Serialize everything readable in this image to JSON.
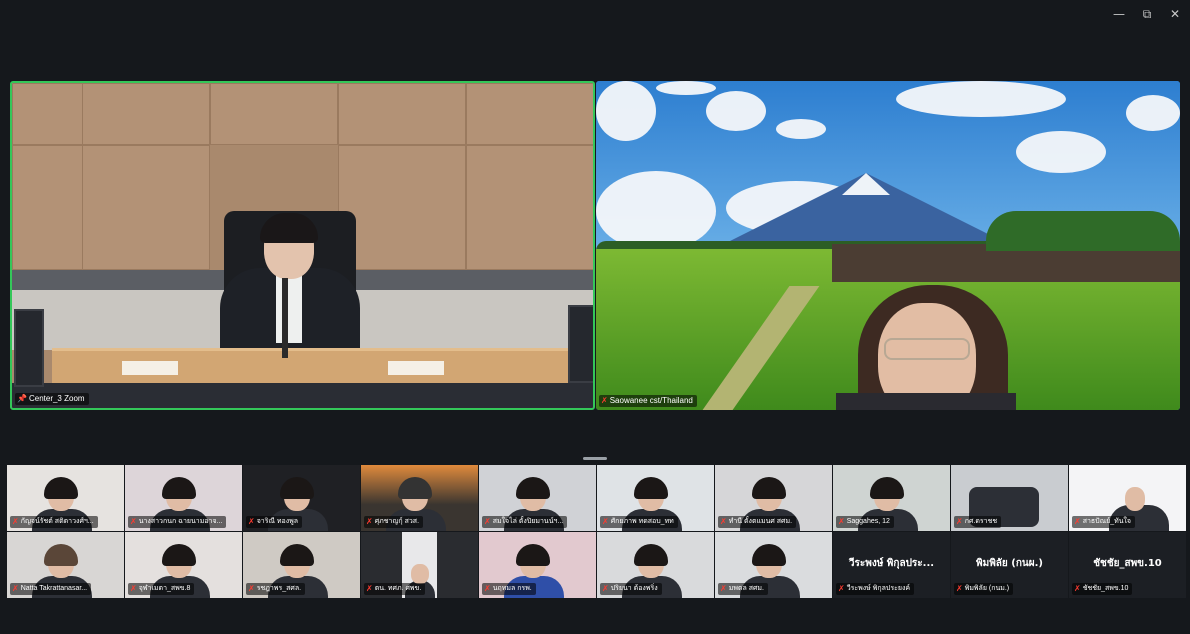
{
  "window": {
    "minimize_icon": "minimize-icon",
    "restore_icon": "restore-icon",
    "close_icon": "close-icon"
  },
  "main_speakers": [
    {
      "name": "Center_3 Zoom",
      "pinned": true,
      "muted": false,
      "active": true,
      "scene": "conference room"
    },
    {
      "name": "Saowanee cst/Thailand",
      "pinned": false,
      "muted": true,
      "active": false,
      "scene": "Mount Fuji tea field virtual background"
    }
  ],
  "participants": [
    {
      "name": "กัญจน์รัชต์ สติตาวงศ์ฯ...",
      "muted": true,
      "bg": "#e6e3e0"
    },
    {
      "name": "นางสาวกนก ฉายนามอาจ...",
      "muted": true,
      "bg": "#ddd5d9"
    },
    {
      "name": "จาริณี ทองพูล",
      "muted": true,
      "bg": "#1f2024"
    },
    {
      "name": "ศุภชาญกุ์ สวส.",
      "muted": true,
      "bg": "#3a3530"
    },
    {
      "name": "สมใจไล่ ตั้งปิยมานน์ฯ...",
      "muted": true,
      "bg": "#d0d2d6"
    },
    {
      "name": "ศักยภาพ ทดสอบ_ทท",
      "muted": true,
      "bg": "#dfe3e6"
    },
    {
      "name": "ทำนี ตั้งตแมนศ สศม.",
      "muted": true,
      "bg": "#d6d6d8"
    },
    {
      "name": "Saggahes, 12",
      "muted": true,
      "bg": "#cfd4d2"
    },
    {
      "name": "กศ.ดราชช",
      "muted": true,
      "bg": "#c9ccd0"
    },
    {
      "name": "สาธปัณย์_ทันใจ",
      "muted": true,
      "bg": "#f4f4f6"
    },
    {
      "name": "Natta Takrattanasar...",
      "muted": true,
      "bg": "#d8d6d4"
    },
    {
      "name": "จุฬาเมตา_สพข.8",
      "muted": true,
      "bg": "#e4e0de"
    },
    {
      "name": "รชฎาพร_สศล.",
      "muted": true,
      "bg": "#cfcac4"
    },
    {
      "name": "ตน. ทศภ. ศพข.",
      "muted": true,
      "bg": "#2a2c30"
    },
    {
      "name": "นฤทมล กรพ.",
      "muted": true,
      "bg": "#e2c9cf"
    },
    {
      "name": "ปริยนา ต้องพริ่ง",
      "muted": true,
      "bg": "#d9dadc"
    },
    {
      "name": "มพตล สศม.",
      "muted": true,
      "bg": "#dadcde"
    },
    {
      "name": "วีระพงษ์ พิกุลประยงค์",
      "display": "วีระพงษ์ พิกุลประ...",
      "muted": true,
      "bg": "#1c1f24"
    },
    {
      "name": "พิมพิลัย (กนม.)",
      "display": "พิมพิลัย (กนผ.)",
      "muted": true,
      "bg": "#1c1f24"
    },
    {
      "name": "ชัชชัย_สพข.10",
      "display": "ชัชชัย_สพข.10",
      "muted": true,
      "bg": "#1c1f24"
    }
  ]
}
